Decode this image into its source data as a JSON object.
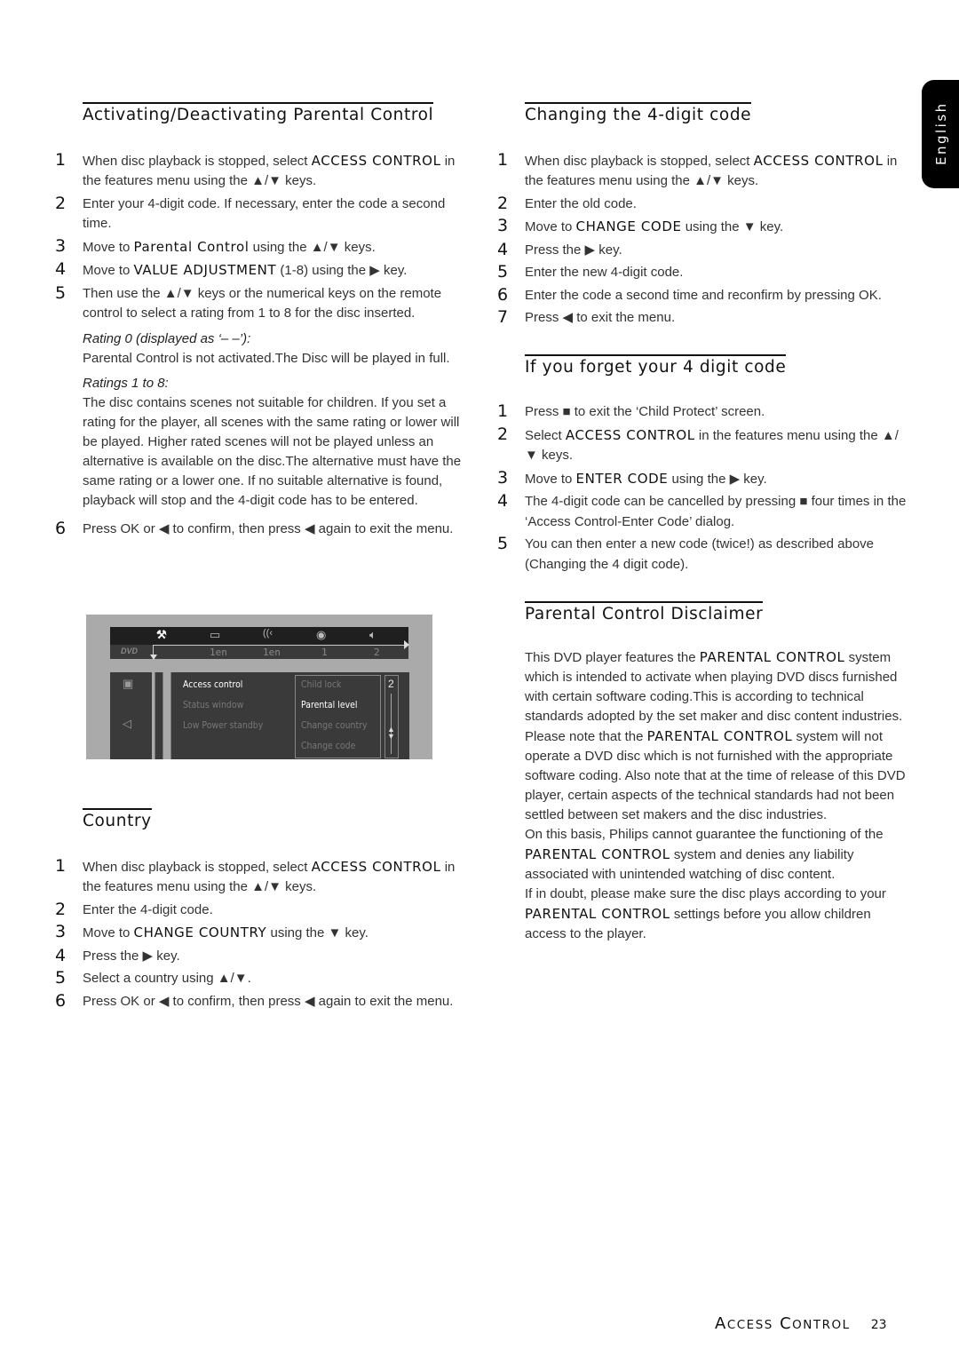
{
  "left": {
    "activating": {
      "title": "Activating/Deactivating Parental Control",
      "steps": [
        {
          "n": "1",
          "pre": "When disc playback is stopped, select ",
          "kw": "ACCESS CONTROL",
          "post": " in the features menu using the ▲/▼ keys."
        },
        {
          "n": "2",
          "pre": "Enter your 4-digit code. If necessary, enter the code a second time.",
          "kw": "",
          "post": ""
        },
        {
          "n": "3",
          "pre": "Move to ",
          "kw": "Parental Control",
          "post": " using the ▲/▼ keys."
        },
        {
          "n": "4",
          "pre": "Move to ",
          "kw": "VALUE ADJUSTMENT",
          "post": " (1-8) using the ▶ key."
        },
        {
          "n": "5",
          "pre": "Then use the ▲/▼ keys or the numerical keys on the remote control to select a rating from 1 to 8 for the disc inserted.",
          "kw": "",
          "post": ""
        }
      ],
      "rating0_label": "Rating 0 (displayed as ‘– –’):",
      "rating0_text": "Parental Control is not activated.The Disc will be played in full.",
      "ratings_label": "Ratings 1 to 8:",
      "ratings_text": "The disc contains scenes not suitable for children. If you set a rating for the player, all scenes with the same rating or lower will be played. Higher rated scenes will not be played unless an alternative is available on the disc.The alternative must have the same rating or a lower one. If no suitable alternative is found, playback will stop and the 4-digit code has to be entered.",
      "step6": {
        "n": "6",
        "text": "Press OK or ◀ to confirm, then press ◀ again to exit the menu."
      }
    },
    "osd": {
      "top_icons": [
        "features-icon",
        "subtitle-icon",
        "audio-icon",
        "disc-icon",
        "speaker-icon"
      ],
      "top_values": [
        "1en",
        "1en",
        "1",
        "2"
      ],
      "dvd_logo": "DVD",
      "menu_items": [
        "Access control",
        "Status window",
        "Low Power standby"
      ],
      "selected_menu": "Access control",
      "sub_items": [
        "Child lock",
        "Parental level",
        "Change country",
        "Change code"
      ],
      "selected_sub": "Parental level",
      "value": "2"
    },
    "country": {
      "title": "Country",
      "steps": [
        {
          "n": "1",
          "pre": "When disc playback is stopped, select ",
          "kw": "ACCESS CONTROL",
          "post": " in the features menu using the ▲/▼ keys."
        },
        {
          "n": "2",
          "pre": "Enter the 4-digit code.",
          "kw": "",
          "post": ""
        },
        {
          "n": "3",
          "pre": "Move to ",
          "kw": "CHANGE COUNTRY",
          "post": " using the ▼ key."
        },
        {
          "n": "4",
          "pre": "Press the ▶ key.",
          "kw": "",
          "post": ""
        },
        {
          "n": "5",
          "pre": "Select a country using ▲/▼.",
          "kw": "",
          "post": ""
        },
        {
          "n": "6",
          "pre": "Press OK or ◀ to confirm, then press ◀ again to exit the menu.",
          "kw": "",
          "post": ""
        }
      ]
    }
  },
  "right": {
    "changing": {
      "title": "Changing the 4-digit code",
      "steps": [
        {
          "n": "1",
          "pre": "When disc playback is stopped, select ",
          "kw": "ACCESS CONTROL",
          "post": " in the features menu using the ▲/▼ keys."
        },
        {
          "n": "2",
          "pre": "Enter the old code.",
          "kw": "",
          "post": ""
        },
        {
          "n": "3",
          "pre": "Move to ",
          "kw": "CHANGE CODE",
          "post": " using the ▼ key."
        },
        {
          "n": "4",
          "pre": "Press the ▶ key.",
          "kw": "",
          "post": ""
        },
        {
          "n": "5",
          "pre": "Enter the new 4-digit code.",
          "kw": "",
          "post": ""
        },
        {
          "n": "6",
          "pre": "Enter the code a second time and reconfirm by pressing OK.",
          "kw": "",
          "post": ""
        },
        {
          "n": "7",
          "pre": "Press ◀ to exit the menu.",
          "kw": "",
          "post": ""
        }
      ]
    },
    "forget": {
      "title": "If you forget your 4 digit code",
      "steps": [
        {
          "n": "1",
          "pre": "Press ■ to exit the ‘Child Protect’ screen.",
          "kw": "",
          "post": ""
        },
        {
          "n": "2",
          "pre": "Select ",
          "kw": "ACCESS CONTROL",
          "post": " in the features menu using the ▲/▼ keys."
        },
        {
          "n": "3",
          "pre": "Move to ",
          "kw": "ENTER CODE",
          "post": " using the ▶ key."
        },
        {
          "n": "4",
          "pre": "The 4-digit code can be cancelled by pressing ■ four times in the ‘Access Control-Enter Code’ dialog.",
          "kw": "",
          "post": ""
        },
        {
          "n": "5",
          "pre": "You can then enter a new code (twice!) as described above (Changing the 4 digit code).",
          "kw": "",
          "post": ""
        }
      ]
    },
    "disclaimer": {
      "title": "Parental Control Disclaimer",
      "paragraphs": [
        {
          "pre": "This DVD player features the ",
          "kw": "PARENTAL CONTROL",
          "post": " system which is intended to activate when playing DVD discs furnished with certain software coding.This is according to technical standards adopted by the set maker and disc content industries."
        },
        {
          "pre": "Please note that the ",
          "kw": "PARENTAL CONTROL",
          "post": " system will not operate a DVD disc which is not furnished with the appropriate software coding. Also note that at the time of release of this DVD player, certain aspects of the technical standards had not been settled between set makers and the disc industries."
        },
        {
          "pre": "On this basis, Philips cannot guarantee the functioning of the ",
          "kw": "PARENTAL CONTROL",
          "post": " system and denies any liability associated with unintended watching of disc content."
        },
        {
          "pre": "If in doubt, please make sure the disc plays according to your ",
          "kw": "PARENTAL CONTROL",
          "post": " settings before you allow children access to the player."
        }
      ]
    }
  },
  "language_tab": "English",
  "footer": {
    "section": "Access Control",
    "page": "23"
  }
}
